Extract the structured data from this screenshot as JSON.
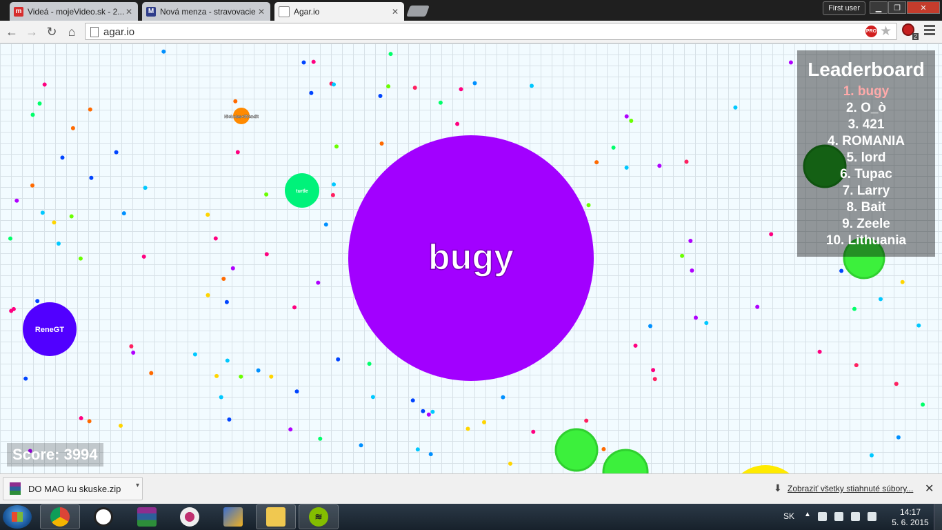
{
  "browser": {
    "tabs": [
      {
        "title": "Videá - mojeVideo.sk - 2...",
        "favicon_letter": "m",
        "favicon_color": "#d62d2d"
      },
      {
        "title": "Nová menza - stravovacie",
        "favicon_letter": "M",
        "favicon_color": "#2f3d8a"
      },
      {
        "title": "Agar.io",
        "favicon_letter": "",
        "favicon_color": "#ffffff"
      }
    ],
    "user_label": "First user",
    "url": "agar.io",
    "pro_badge": "PRO",
    "ext_badge_count": "2"
  },
  "game": {
    "grid_color": "#d7e1e7",
    "background_color": "#f2fbff",
    "leaderboard": {
      "title": "Leaderboard",
      "entries": [
        "1. bugy",
        "2. O_ò",
        "3. 421",
        "4. ROMANIA",
        "5. lord",
        "6. Tupac",
        "7. Larry",
        "8. Bait",
        "9. Zeele",
        "10. Lithuania"
      ],
      "highlight_color": "#ffaaaa"
    },
    "score_label": "Score: 3994",
    "cells": [
      {
        "name": "bugy",
        "color": "#a200ff"
      },
      {
        "name": "ReneGT",
        "color": "#5100ff"
      },
      {
        "name": "turtle",
        "color": "#00f27a"
      },
      {
        "name": "Nicholas+3Vendit",
        "color": "#ff8a00"
      }
    ]
  },
  "downloads": {
    "file_name": "DO MAO ku skuske.zip",
    "show_all_label": "Zobraziť všetky stiahnuté súbory..."
  },
  "taskbar": {
    "language": "SK",
    "time": "14:17",
    "date": "5. 6. 2015"
  }
}
